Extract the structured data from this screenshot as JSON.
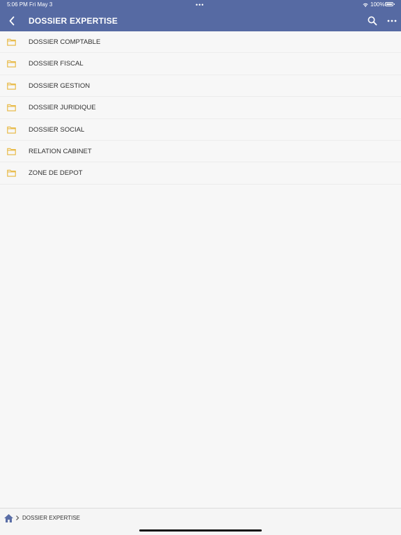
{
  "status": {
    "time": "5:06 PM",
    "date": "Fri May 3",
    "dots": "•••",
    "battery": "100%"
  },
  "nav": {
    "title": "DOSSIER EXPERTISE",
    "icons": [
      "back-chevron-icon",
      "search-icon",
      "more-icon"
    ]
  },
  "folders": [
    {
      "label": "DOSSIER COMPTABLE"
    },
    {
      "label": "DOSSIER FISCAL"
    },
    {
      "label": "DOSSIER GESTION"
    },
    {
      "label": "DOSSIER JURIDIQUE"
    },
    {
      "label": "DOSSIER SOCIAL"
    },
    {
      "label": "RELATION CABINET"
    },
    {
      "label": "ZONE DE DEPOT"
    }
  ],
  "breadcrumb": {
    "current": "DOSSIER EXPERTISE"
  },
  "colors": {
    "header": "#566aa3",
    "folder": "#e7b63b",
    "home": "#5a6ea6"
  }
}
